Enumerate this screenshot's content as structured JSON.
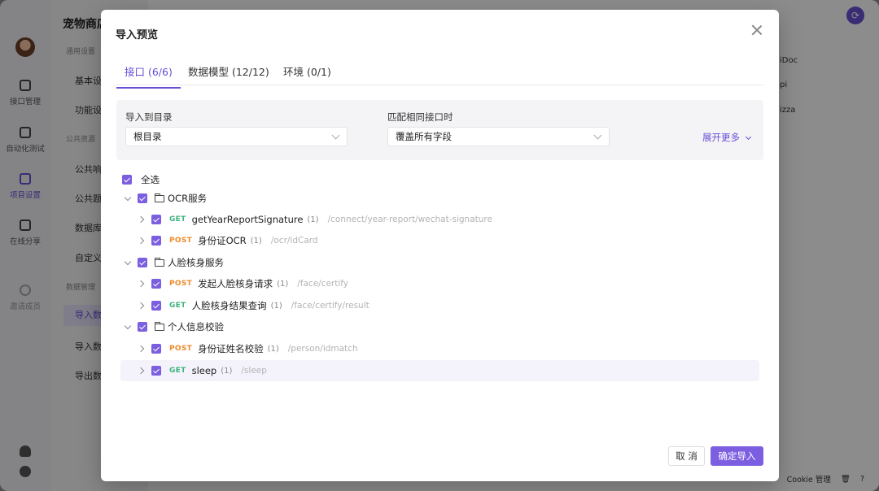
{
  "bg": {
    "rail": {
      "items": [
        {
          "label": "接口管理"
        },
        {
          "label": "自动化测试"
        },
        {
          "label": "项目设置"
        },
        {
          "label": "在线分享"
        },
        {
          "label": "邀请成员"
        }
      ]
    },
    "sidebar": {
      "title": "宠物商店",
      "groups": [
        "通用设置",
        "公共资源",
        "数据管理"
      ],
      "items": [
        "基本设",
        "功能设",
        "公共响",
        "公共题",
        "数据库",
        "自定义",
        "导入数",
        "导入数",
        "导出数"
      ]
    },
    "main_fragments": [
      "iDoc",
      "pi",
      "izza"
    ],
    "bottombar": {
      "cookie_label": "Cookie 管理"
    }
  },
  "modal": {
    "title": "导入预览",
    "tabs": [
      {
        "label": "接口 (6/6)"
      },
      {
        "label": "数据模型 (12/12)"
      },
      {
        "label": "环境 (0/1)"
      }
    ],
    "import_to": {
      "label": "导入到目录",
      "value": "根目录"
    },
    "match_rule": {
      "label": "匹配相同接口时",
      "value": "覆盖所有字段"
    },
    "expand_more": "展开更多",
    "select_all": "全选",
    "groups": [
      {
        "name": "OCR服务",
        "endpoints": [
          {
            "method": "GET",
            "name": "getYearReportSignature",
            "count": "(1)",
            "path": "/connect/year-report/wechat-signature"
          },
          {
            "method": "POST",
            "name": "身份证OCR",
            "count": "(1)",
            "path": "/ocr/idCard"
          }
        ]
      },
      {
        "name": "人脸核身服务",
        "endpoints": [
          {
            "method": "POST",
            "name": "发起人脸核身请求",
            "count": "(1)",
            "path": "/face/certify"
          },
          {
            "method": "GET",
            "name": "人脸核身结果查询",
            "count": "(1)",
            "path": "/face/certify/result"
          }
        ]
      },
      {
        "name": "个人信息校验",
        "endpoints": [
          {
            "method": "POST",
            "name": "身份证姓名校验",
            "count": "(1)",
            "path": "/person/idmatch"
          },
          {
            "method": "GET",
            "name": "sleep",
            "count": "(1)",
            "path": "/sleep"
          }
        ]
      }
    ],
    "cancel_label": "取 消",
    "confirm_label": "确定导入"
  },
  "colors": {
    "accent": "#7c5fe0",
    "get": "#3fb27f",
    "post": "#ef8b2c"
  }
}
